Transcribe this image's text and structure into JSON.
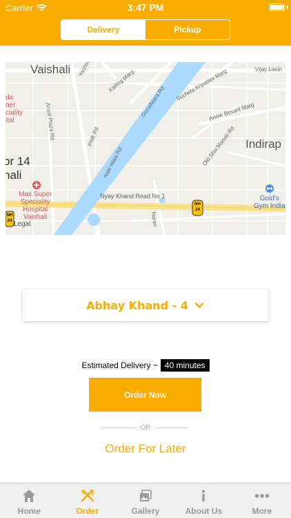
{
  "status_bar": {
    "carrier": "Carrier",
    "time": "3:47 PM"
  },
  "segmented": {
    "options": [
      "Delivery",
      "Pickup"
    ],
    "selected": "Delivery"
  },
  "map": {
    "labels": {
      "vaishali": "Vaishali",
      "indirap": "Indirap",
      "sector": "or 14",
      "sector_name": "hali",
      "left_text_1": "da",
      "left_text_2": "ner",
      "left_text_3": "ciality",
      "left_text_4": "ital",
      "max_hospital_1": "Max Super",
      "max_hospital_2": "Speciality",
      "max_hospital_3": "Hospital",
      "max_hospital_4": "Vaishali",
      "golds_gym_1": "Gold's",
      "golds_gym_2": "Gym India",
      "legal": "Legal",
      "nyay_khand": "Nyay Khand Road No 1",
      "nh_label": "NH",
      "nh_number": "24",
      "yashodha": "Yashodha",
      "kailing": "Kailing Marg",
      "gurudwara": "Gurudwara Rd",
      "sucheta": "Sucheta Kripalani Marg",
      "vijay": "Vijay Laxm",
      "annie": "Annie Besant Marg",
      "ansal": "Ansal Plaza Rd",
      "pnb": "PNB Rd",
      "nale_wala": "Nale Wala Rd",
      "old_shiv": "Old Shiv Mandir Rd",
      "nuran": "Nuran"
    }
  },
  "location": {
    "name": "Abhay Khand - 4"
  },
  "delivery": {
    "estimate_label": "Estimated Delivery ~",
    "estimate_value": "40 minutes"
  },
  "actions": {
    "order_now": "Order Now",
    "or_text": "OR",
    "order_later": "Order For Later"
  },
  "tabbar": {
    "items": [
      {
        "label": "Home",
        "icon": "home-icon"
      },
      {
        "label": "Order",
        "icon": "fork-knife-icon"
      },
      {
        "label": "Gallery",
        "icon": "gallery-icon"
      },
      {
        "label": "About Us",
        "icon": "info-icon"
      },
      {
        "label": "More",
        "icon": "more-icon"
      }
    ],
    "active": "Order"
  },
  "colors": {
    "brand": "#F8AC00",
    "river": "#aadaff",
    "map_bg": "#f1efe9"
  }
}
